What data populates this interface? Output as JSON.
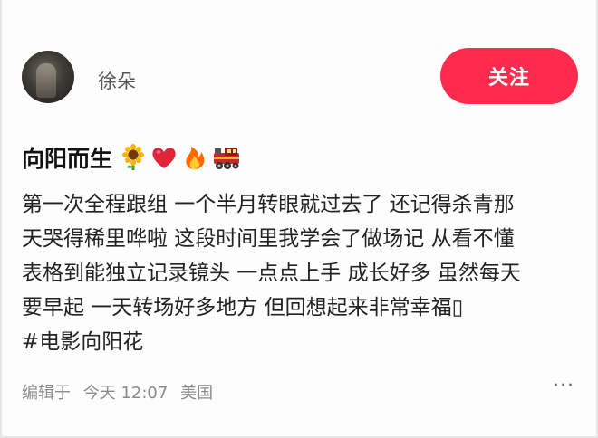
{
  "user": {
    "name": "徐朵",
    "follow_label": "关注"
  },
  "post": {
    "title": "向阳而生",
    "emojis": [
      "sunflower-icon",
      "heart-icon",
      "fire-icon",
      "train-icon"
    ],
    "lines": [
      "第一次全程跟组 一个半月转眼就过去了 还记得杀青那",
      "天哭得稀里哗啦 这段时间里我学会了做场记 从看不懂",
      "表格到能独立记录镜头 一点点上手 成长好多 虽然每天",
      "要早起 一天转场好多地方 但回想起来非常幸福▯",
      "#电影向阳花"
    ]
  },
  "meta": {
    "prefix": "编辑于",
    "time": "今天 12:07",
    "location": "美国",
    "more": "···"
  },
  "colors": {
    "accent": "#ff2a4d"
  }
}
